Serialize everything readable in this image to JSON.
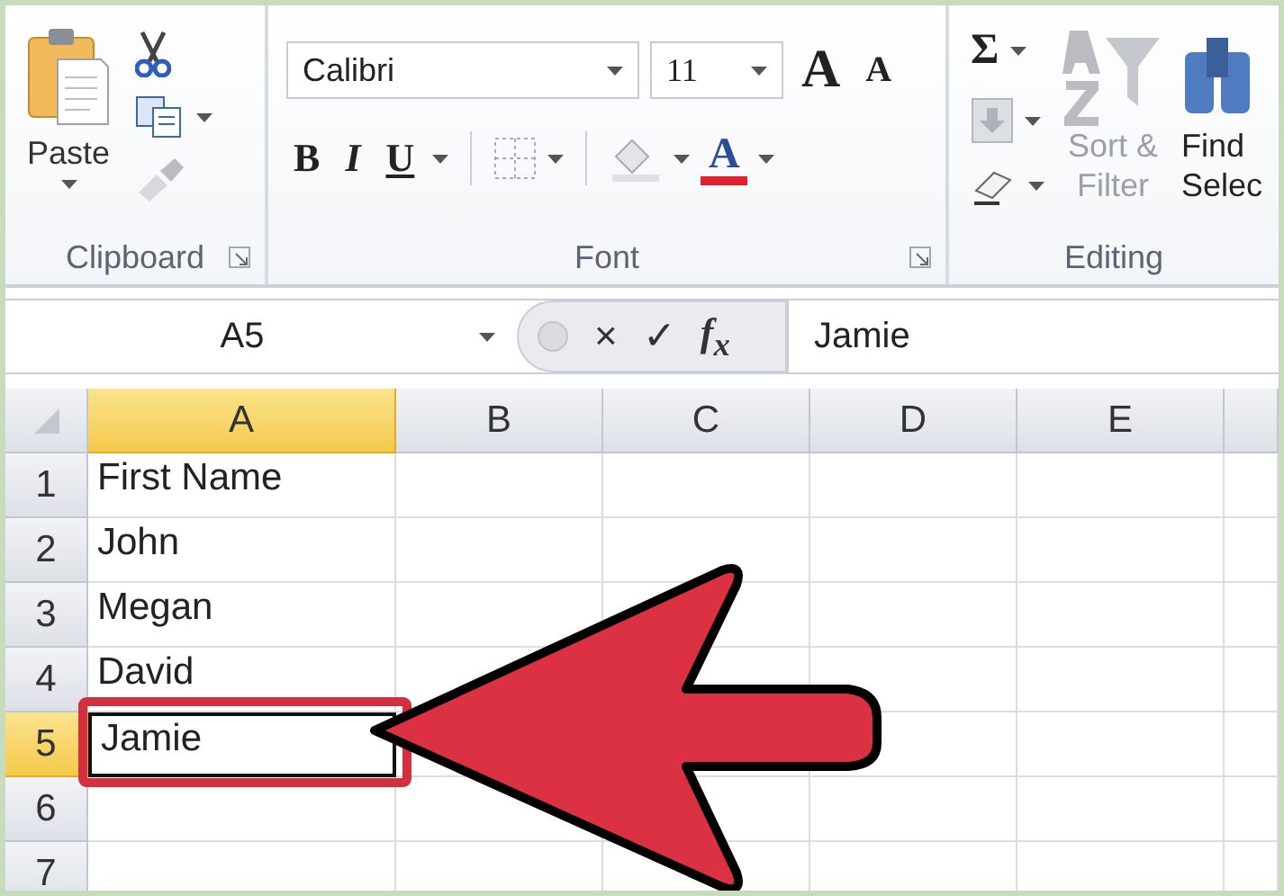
{
  "ribbon": {
    "clipboard": {
      "paste": "Paste",
      "label": "Clipboard"
    },
    "font": {
      "font_name": "Calibri",
      "font_size": "11",
      "grow": "A",
      "shrink": "A",
      "bold": "B",
      "italic": "I",
      "underline": "U",
      "font_color": "A",
      "label": "Font"
    },
    "editing": {
      "sum": "Σ",
      "sort": [
        "Sort &",
        "Filter"
      ],
      "find": [
        "Find",
        "Selec"
      ],
      "label": "Editing"
    }
  },
  "formula_bar": {
    "name_box": "A5",
    "cancel": "×",
    "enter": "✓",
    "function": "f$_{x}$",
    "value": "Jamie"
  },
  "columns": [
    {
      "label": "A",
      "selected": true
    },
    {
      "label": "B",
      "selected": false
    },
    {
      "label": "C",
      "selected": false
    },
    {
      "label": "D",
      "selected": false
    },
    {
      "label": "E",
      "selected": false
    }
  ],
  "rows": [
    {
      "label": "1",
      "selected": false,
      "value": "First Name",
      "active": false
    },
    {
      "label": "2",
      "selected": false,
      "value": "John",
      "active": false
    },
    {
      "label": "3",
      "selected": false,
      "value": "Megan",
      "active": false
    },
    {
      "label": "4",
      "selected": false,
      "value": "David",
      "active": false
    },
    {
      "label": "5",
      "selected": true,
      "value": "Jamie",
      "active": true
    },
    {
      "label": "6",
      "selected": false,
      "active": false
    },
    {
      "label": "7",
      "selected": false,
      "active": false
    }
  ]
}
